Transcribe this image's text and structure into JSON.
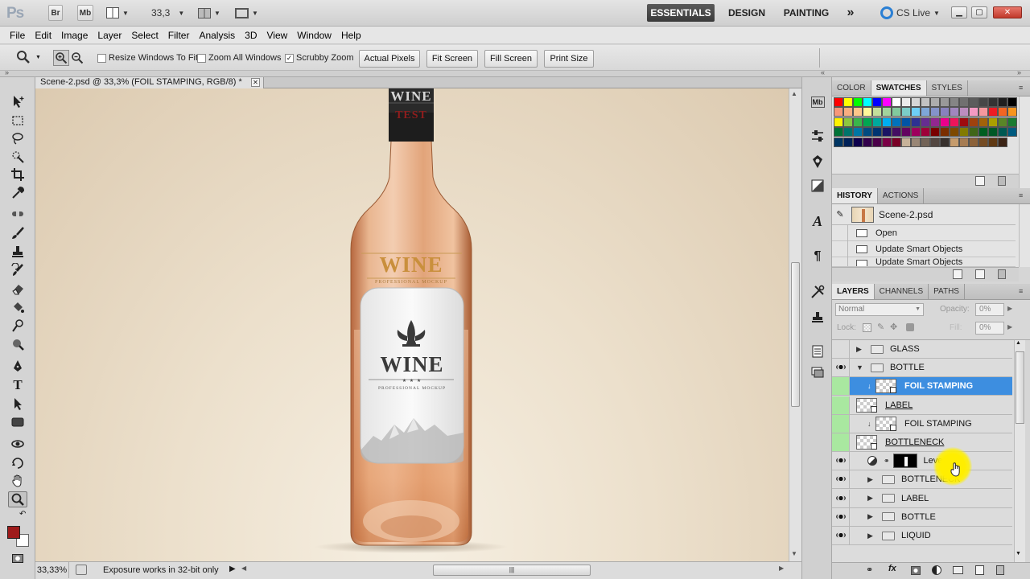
{
  "appbar": {
    "logo": "Ps",
    "bridge": "Br",
    "minibridge": "Mb",
    "zoom": "33,3",
    "workspaces": [
      "ESSENTIALS",
      "DESIGN",
      "PAINTING"
    ],
    "more": "»",
    "cslive": "CS Live"
  },
  "menu": [
    "File",
    "Edit",
    "Image",
    "Layer",
    "Select",
    "Filter",
    "Analysis",
    "3D",
    "View",
    "Window",
    "Help"
  ],
  "options": {
    "resize_windows": "Resize Windows To Fit",
    "zoom_all": "Zoom All Windows",
    "scrubby": "Scrubby Zoom",
    "actual_pixels": "Actual Pixels",
    "fit_screen": "Fit Screen",
    "fill_screen": "Fill Screen",
    "print_size": "Print Size",
    "resize_checked": false,
    "zoom_all_checked": false,
    "scrubby_checked": true
  },
  "document": {
    "tab_title": "Scene-2.psd @ 33,3% (FOIL STAMPING, RGB/8) *",
    "zoom": "33,33%",
    "status_message": "Exposure works in 32-bit only"
  },
  "bottle": {
    "neck_top": "WINE",
    "neck_bottom": "TEST",
    "shoulder": "WINE",
    "shoulder_sub": "PROFESSIONAL MOCKUP",
    "label_title": "WINE",
    "label_stars": "★ ★ ★",
    "label_sub": "PROFESSIONAL MOCKUP"
  },
  "swatches_panel": {
    "tabs": [
      "COLOR",
      "SWATCHES",
      "STYLES"
    ],
    "active": "SWATCHES",
    "colors": [
      [
        "#ff0000",
        "#ffff00",
        "#00ff00",
        "#00ffff",
        "#0000ff",
        "#ff00ff",
        "#ffffff",
        "#ebebeb",
        "#d6d6d6",
        "#c2c2c2",
        "#adadad",
        "#999999",
        "#858585",
        "#707070",
        "#5c5c5c",
        "#474747",
        "#333333",
        "#1f1f1f",
        "#000000"
      ],
      [
        "#f7977a",
        "#f9ad81",
        "#fdc68a",
        "#fff79a",
        "#c4df9b",
        "#a2d39c",
        "#82ca9d",
        "#7bcdc8",
        "#6ecff6",
        "#7ea7d8",
        "#8493ca",
        "#8882be",
        "#a187be",
        "#bc8dbf",
        "#f49ac2",
        "#f6989d",
        "#ed1c24",
        "#f26522",
        "#f7941d"
      ],
      [
        "#fff200",
        "#8dc63f",
        "#39b54a",
        "#00a651",
        "#00a99d",
        "#00aeef",
        "#0072bc",
        "#0054a6",
        "#2e3192",
        "#662d91",
        "#92278f",
        "#ec008c",
        "#ed145b",
        "#9e0b0f",
        "#a0410d",
        "#a36209",
        "#aba000",
        "#598527",
        "#1a7b30"
      ],
      [
        "#007236",
        "#00746b",
        "#0076a3",
        "#004b80",
        "#003471",
        "#1b1464",
        "#440e62",
        "#630460",
        "#9e005d",
        "#9e0039",
        "#790000",
        "#7b2e00",
        "#7d4900",
        "#827b00",
        "#406618",
        "#005e20",
        "#005826",
        "#005952",
        "#005b7f"
      ],
      [
        "#003663",
        "#002157",
        "#0d004c",
        "#32004b",
        "#4b0049",
        "#7b0046",
        "#7a0026",
        "#c7b299",
        "#998675",
        "#736357",
        "#534741",
        "#37302d",
        "#c69c6d",
        "#a67c52",
        "#8c6239",
        "#754c24",
        "#603913",
        "#3c2415"
      ]
    ]
  },
  "history_panel": {
    "tabs": [
      "HISTORY",
      "ACTIONS"
    ],
    "active": "HISTORY",
    "snapshot": "Scene-2.psd",
    "steps": [
      "Open",
      "Update Smart Objects",
      "Update Smart Objects"
    ]
  },
  "layers_panel": {
    "tabs": [
      "LAYERS",
      "CHANNELS",
      "PATHS"
    ],
    "active": "LAYERS",
    "blend_mode": "Normal",
    "opacity_label": "Opacity:",
    "opacity": "0%",
    "lock_label": "Lock:",
    "fill_label": "Fill:",
    "fill": "0%",
    "layers": [
      {
        "name": "GLASS",
        "type": "group",
        "visible": false,
        "indent": 0,
        "selected": false,
        "expanded": false
      },
      {
        "name": "BOTTLE",
        "type": "group",
        "visible": true,
        "indent": 0,
        "selected": false,
        "expanded": true
      },
      {
        "name": "FOIL STAMPING",
        "type": "smart",
        "visible": false,
        "indent": 1,
        "selected": true,
        "clipped": true
      },
      {
        "name": "LABEL",
        "type": "smart",
        "visible": false,
        "indent": 0,
        "selected": false,
        "underline": true
      },
      {
        "name": "FOIL STAMPING",
        "type": "smart",
        "visible": false,
        "indent": 1,
        "selected": false,
        "clipped": true
      },
      {
        "name": "BOTTLENECK",
        "type": "smart",
        "visible": false,
        "indent": 0,
        "selected": false,
        "underline": true
      },
      {
        "name": "Leve",
        "type": "adjustment",
        "visible": true,
        "indent": 1,
        "selected": false
      },
      {
        "name": "BOTTLENECK",
        "type": "group",
        "visible": true,
        "indent": 1,
        "selected": false,
        "expanded": false
      },
      {
        "name": "LABEL",
        "type": "group",
        "visible": true,
        "indent": 1,
        "selected": false,
        "expanded": false
      },
      {
        "name": "BOTTLE",
        "type": "group",
        "visible": true,
        "indent": 1,
        "selected": false,
        "expanded": false
      },
      {
        "name": "LIQUID",
        "type": "group",
        "visible": true,
        "indent": 1,
        "selected": false,
        "expanded": false
      }
    ]
  },
  "colors": {
    "foreground": "#9e1b1b",
    "background": "#ffffff",
    "selection": "#3d8ee0",
    "active_workspace": "#444444"
  }
}
